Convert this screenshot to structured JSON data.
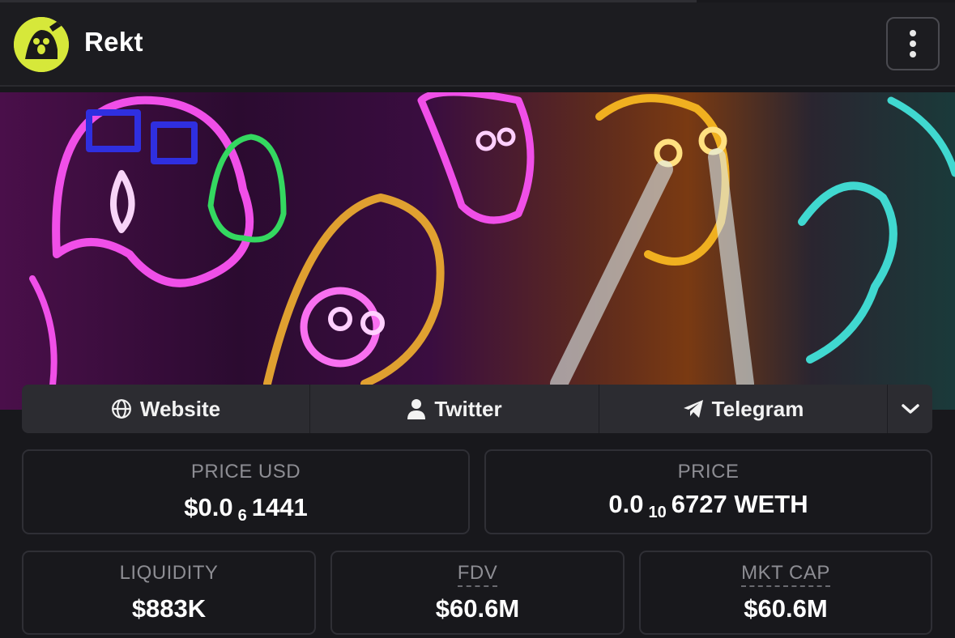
{
  "header": {
    "title": "Rekt",
    "logo_text": "rekt",
    "menu_icon": "kebab-menu-icon"
  },
  "banner": {
    "description_icon": "neon-ghosts-banner"
  },
  "links": [
    {
      "label": "Website",
      "icon": "globe-icon"
    },
    {
      "label": "Twitter",
      "icon": "user-icon"
    },
    {
      "label": "Telegram",
      "icon": "telegram-icon"
    }
  ],
  "more_icon": "chevron-down-icon",
  "stats": {
    "price_usd": {
      "label": "PRICE USD",
      "prefix": "$0.0",
      "sub": "6",
      "suffix": "1441"
    },
    "price": {
      "label": "PRICE",
      "prefix": "0.0",
      "sub": "10",
      "suffix": "6727 WETH"
    },
    "liquidity": {
      "label": "LIQUIDITY",
      "value": "$883K"
    },
    "fdv": {
      "label": "FDV",
      "value": "$60.6M"
    },
    "mkt_cap": {
      "label": "MKT CAP",
      "value": "$60.6M"
    }
  },
  "colors": {
    "background": "#18181c",
    "logo_accent": "#d6e83a"
  }
}
